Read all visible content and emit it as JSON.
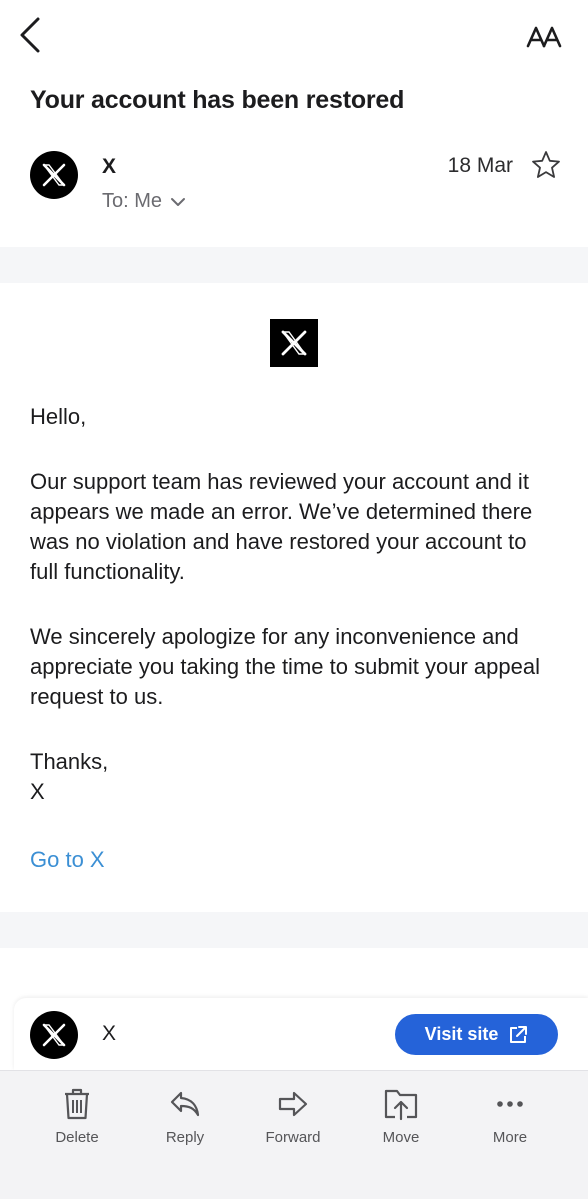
{
  "email": {
    "subject": "Your account has been restored",
    "sender_name": "X",
    "recipient_label": "To: Me",
    "date": "18 Mar",
    "logo_glyph": "𝕏",
    "body": {
      "greeting": "Hello,",
      "paragraph1": "Our support team has reviewed your account and it appears we made an error. We’ve determined there was no violation and have restored your account to full functionality.",
      "paragraph2": "We sincerely apologize for any inconvenience and appreciate you taking the time to submit your appeal request to us.",
      "signoff": "Thanks,",
      "signature": "X"
    },
    "link_text": "Go to X"
  },
  "sender_card": {
    "name": "X",
    "visit_label": "Visit site"
  },
  "toolbar": {
    "items": [
      {
        "label": "Delete",
        "icon": "trash-icon"
      },
      {
        "label": "Reply",
        "icon": "reply-icon"
      },
      {
        "label": "Forward",
        "icon": "forward-icon"
      },
      {
        "label": "Move",
        "icon": "folder-move-icon"
      },
      {
        "label": "More",
        "icon": "more-dots-icon"
      }
    ]
  },
  "colors": {
    "link": "#3b8fd4",
    "visit_button": "#2563d9",
    "toolbar_bg": "#f3f3f5"
  }
}
